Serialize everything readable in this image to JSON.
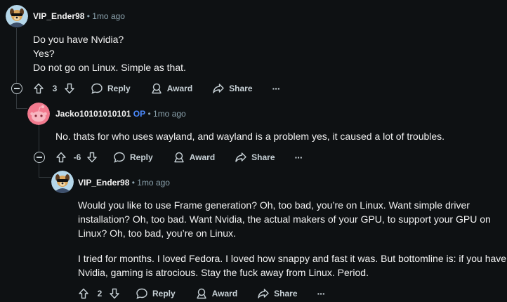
{
  "comments": [
    {
      "username": "VIP_Ender98",
      "time": "1mo ago",
      "body": [
        "Do you have Nvidia?",
        "Yes?",
        "Do not go on Linux. Simple as that."
      ],
      "votes": "3",
      "reply": "Reply",
      "award": "Award",
      "share": "Share",
      "more": "···"
    },
    {
      "username": "Jacko10101010101",
      "op": "OP",
      "time": "1mo ago",
      "body": [
        "No. thats for who uses wayland, and wayland is a problem yes, it caused a lot of troubles."
      ],
      "votes": "-6",
      "reply": "Reply",
      "award": "Award",
      "share": "Share",
      "more": "···"
    },
    {
      "username": "VIP_Ender98",
      "time": "1mo ago",
      "body": [
        "Would you like to use Frame generation? Oh, too bad, you’re on Linux. Want simple driver installation? Oh, too bad. Want Nvidia, the actual makers of your GPU, to support your GPU on Linux? Oh, too bad, you’re on Linux.",
        "I tried for months. I loved Fedora. I loved how snappy and fast it was. But bottomline is: if you have Nvidia, gaming is atrocious. Stay the fuck away from Linux. Period."
      ],
      "votes": "2",
      "reply": "Reply",
      "award": "Award",
      "share": "Share",
      "more": "···"
    }
  ],
  "separator": "•",
  "icons": [
    "collapse-icon",
    "upvote-icon",
    "downvote-icon",
    "reply-icon",
    "award-icon",
    "share-icon",
    "more-icon"
  ]
}
